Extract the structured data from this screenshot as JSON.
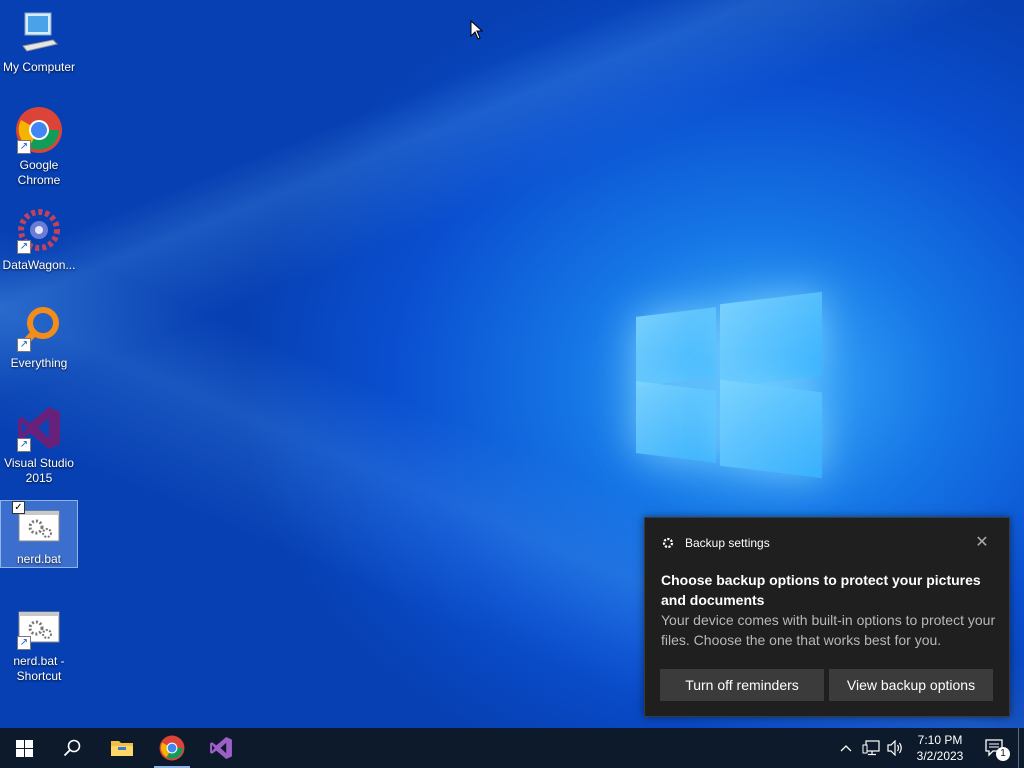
{
  "desktop": {
    "icons": [
      {
        "label": "My Computer"
      },
      {
        "label": "Google Chrome"
      },
      {
        "label": "DataWagon..."
      },
      {
        "label": "Everything"
      },
      {
        "label": "Visual Studio 2015"
      },
      {
        "label": "nerd.bat"
      },
      {
        "label": "nerd.bat - Shortcut"
      }
    ]
  },
  "notification": {
    "app_name": "Backup settings",
    "title": "Choose backup options to protect your pictures and documents",
    "body": "Your device comes with built-in options to protect your files. Choose the one that works best for you.",
    "buttons": [
      {
        "label": "Turn off reminders"
      },
      {
        "label": "View backup options"
      }
    ],
    "close_glyph": "✕"
  },
  "taskbar": {
    "items": [
      "start-button",
      "search-button",
      "file-explorer",
      "google-chrome",
      "visual-studio"
    ],
    "clock": {
      "time": "7:10 PM",
      "date": "3/2/2023"
    },
    "notification_count": "1"
  },
  "colors": {
    "taskbar": "#0d1a2b",
    "toast_bg": "#1f1f1f",
    "toast_button": "#3b3b3b",
    "wallpaper": "#0a4fd0"
  }
}
